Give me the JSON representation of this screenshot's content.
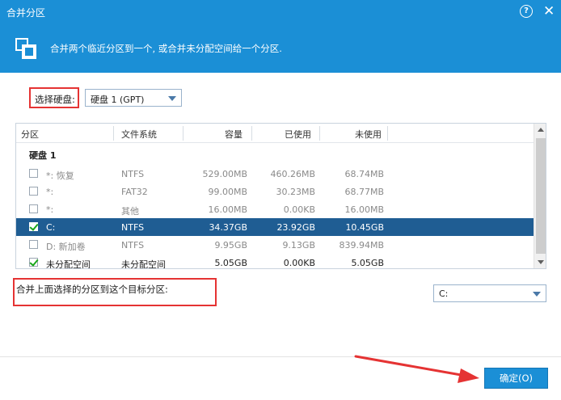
{
  "window": {
    "title": "合并分区",
    "help_glyph": "?",
    "close_glyph": "✕"
  },
  "banner": {
    "text": "合并两个临近分区到一个, 或合并未分配空间给一个分区."
  },
  "disk_select": {
    "label": "选择硬盘:",
    "value": "硬盘 1 (GPT)"
  },
  "table": {
    "columns": [
      "分区",
      "文件系统",
      "容量",
      "已使用",
      "未使用"
    ],
    "group": "硬盘 1",
    "rows": [
      {
        "name": "*: 恢复",
        "fs": "NTFS",
        "capacity": "529.00MB",
        "used": "460.26MB",
        "free": "68.74MB",
        "checked": false,
        "dim": true,
        "selected": false
      },
      {
        "name": "*:",
        "fs": "FAT32",
        "capacity": "99.00MB",
        "used": "30.23MB",
        "free": "68.77MB",
        "checked": false,
        "dim": true,
        "selected": false
      },
      {
        "name": "*:",
        "fs": "其他",
        "capacity": "16.00MB",
        "used": "0.00KB",
        "free": "16.00MB",
        "checked": false,
        "dim": true,
        "selected": false
      },
      {
        "name": "C:",
        "fs": "NTFS",
        "capacity": "34.37GB",
        "used": "23.92GB",
        "free": "10.45GB",
        "checked": true,
        "dim": false,
        "selected": true
      },
      {
        "name": "D: 新加卷",
        "fs": "NTFS",
        "capacity": "9.95GB",
        "used": "9.13GB",
        "free": "839.94MB",
        "checked": false,
        "dim": true,
        "selected": false
      },
      {
        "name": "未分配空间",
        "fs": "未分配空间",
        "capacity": "5.05GB",
        "used": "0.00KB",
        "free": "5.05GB",
        "checked": true,
        "dim": false,
        "selected": false
      }
    ]
  },
  "merge_target": {
    "label": "合并上面选择的分区到这个目标分区:",
    "value": "C:"
  },
  "footer": {
    "ok_label": "确定(O)"
  },
  "colors": {
    "accent": "#1b8fd6",
    "selected_row": "#1f5d93",
    "annotation": "#e53333"
  }
}
